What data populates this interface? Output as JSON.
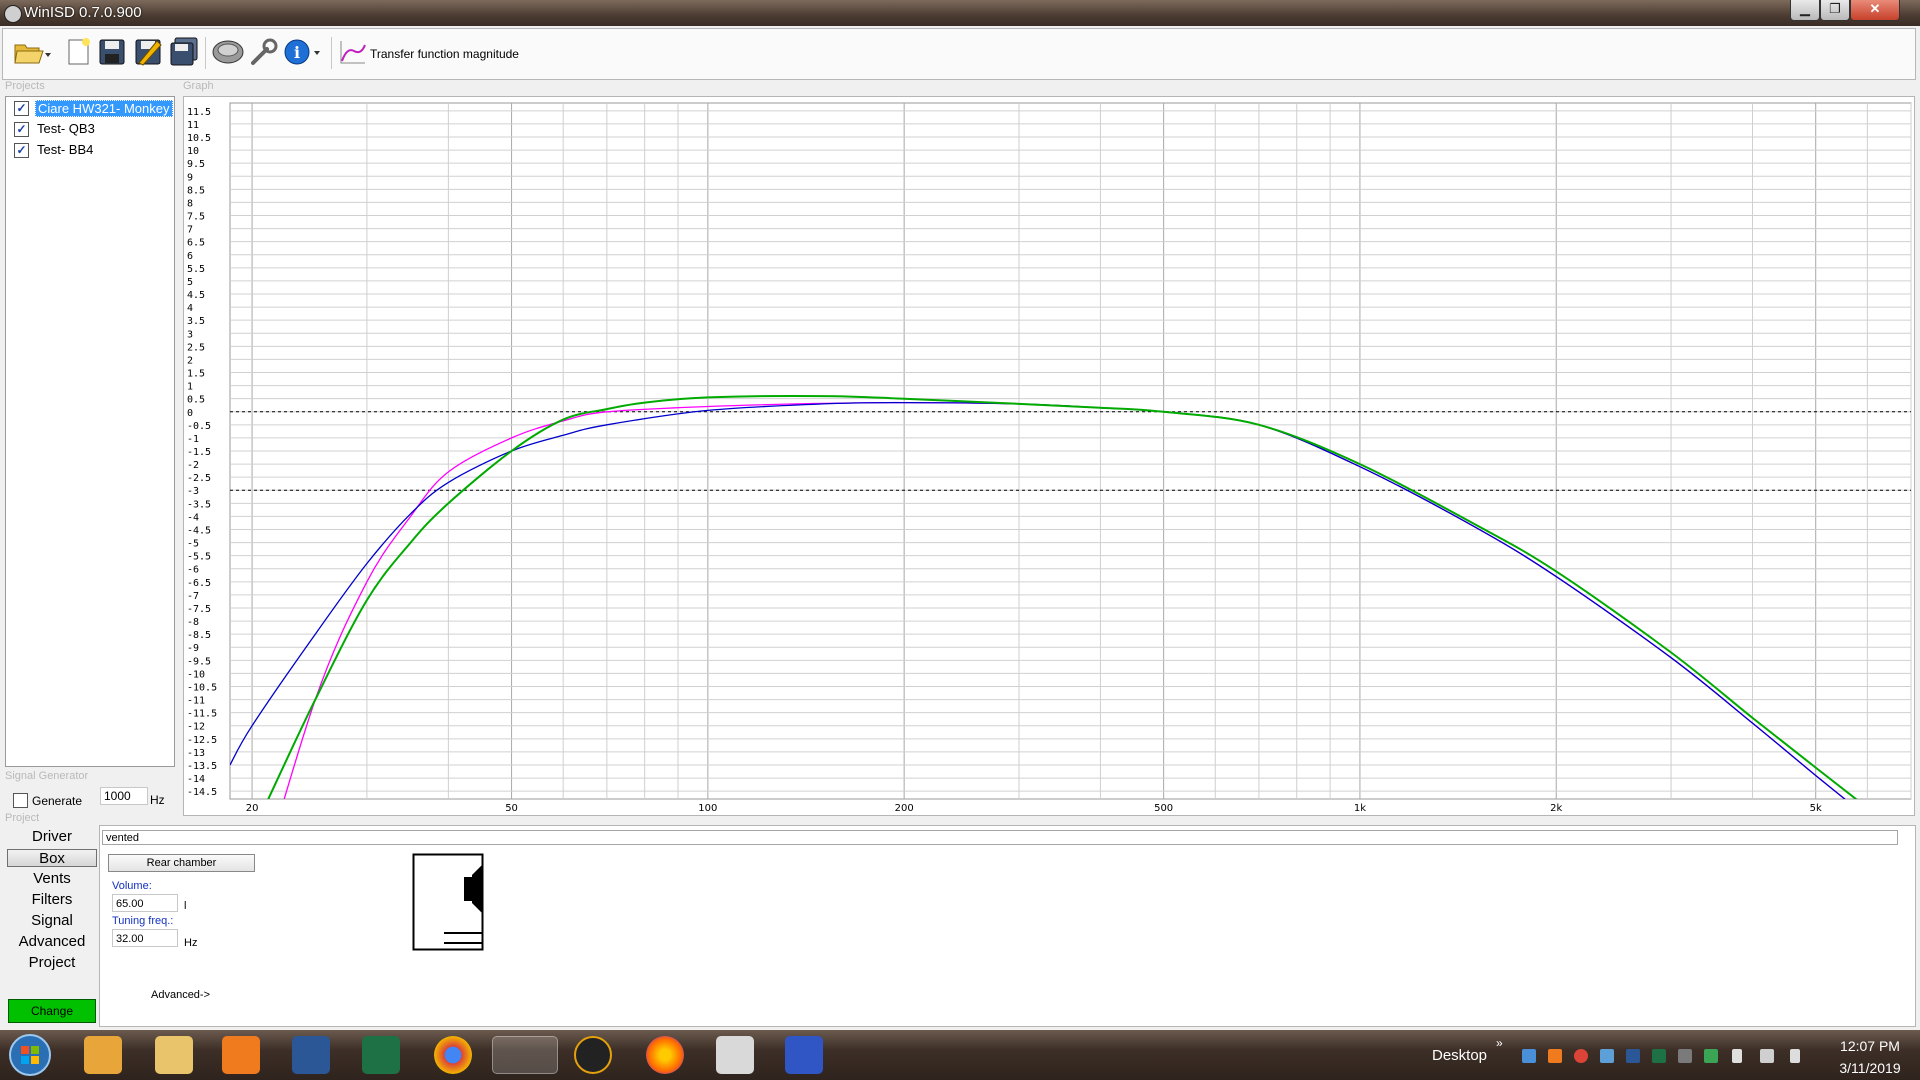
{
  "window": {
    "title": "WinISD 0.7.0.900",
    "minimize": "▁",
    "restore": "❐",
    "close": "✕"
  },
  "toolbar": {
    "tab_label": "Transfer function magnitude"
  },
  "groups": {
    "projects": "Projects",
    "graph": "Graph",
    "signal_generator": "Signal Generator",
    "project": "Project"
  },
  "projects": [
    {
      "label": "Ciare HW321- Monkey",
      "checked": true,
      "selected": true
    },
    {
      "label": "Test- QB3",
      "checked": true,
      "selected": false
    },
    {
      "label": "Test- BB4",
      "checked": true,
      "selected": false
    }
  ],
  "signal": {
    "generate_label": "Generate",
    "frequency": "1000",
    "unit": "Hz"
  },
  "nav": [
    "Driver",
    "Box",
    "Vents",
    "Filters",
    "Signal",
    "Advanced",
    "Project"
  ],
  "nav_selected": "Box",
  "change_label": "Change",
  "box": {
    "type": "vented",
    "rear_chamber": "Rear chamber",
    "volume_label": "Volume:",
    "volume": "65.00",
    "volume_unit": "l",
    "tuning_label": "Tuning freq.:",
    "tuning": "32.00",
    "tuning_unit": "Hz",
    "advanced": "Advanced->"
  },
  "taskbar": {
    "desktop": "Desktop",
    "chevron": "»",
    "time": "12:07 PM",
    "date": "3/11/2019"
  },
  "icons": [
    "open-folder-icon",
    "new-file-icon",
    "save-icon",
    "save-as-icon",
    "save-all-icon",
    "speaker-icon",
    "wrench-icon",
    "info-icon",
    "transfer-function-icon"
  ],
  "chart_data": {
    "type": "line",
    "x_scale": "log",
    "xlim": [
      18.5,
      7000
    ],
    "ylim": [
      -14.8,
      11.8
    ],
    "grid": true,
    "x_ticks": [
      20,
      50,
      100,
      200,
      500,
      1000,
      2000,
      5000
    ],
    "x_tick_labels": [
      "20",
      "50",
      "100",
      "200",
      "500",
      "1k",
      "2k",
      "5k"
    ],
    "y_tick_labels": [
      "11.5",
      "11",
      "10.5",
      "10",
      "9.5",
      "9",
      "8.5",
      "8",
      "7.5",
      "7",
      "6.5",
      "6",
      "5.5",
      "5",
      "4.5",
      "4",
      "3.5",
      "3",
      "2.5",
      "2",
      "1.5",
      "1",
      "0.5",
      "0",
      "-0.5",
      "-1",
      "-1.5",
      "-2",
      "-2.5",
      "-3",
      "-3.5",
      "-4",
      "-4.5",
      "-5",
      "-5.5",
      "-6",
      "-6.5",
      "-7",
      "-7.5",
      "-8",
      "-8.5",
      "-9",
      "-9.5",
      "-10",
      "-10.5",
      "-11",
      "-11.5",
      "-12",
      "-12.5",
      "-13",
      "-13.5",
      "-14",
      "-14.5"
    ],
    "reference_lines": [
      0,
      -3
    ],
    "series": [
      {
        "color": "#ff00ff",
        "points": [
          [
            20,
            -19
          ],
          [
            25,
            -11
          ],
          [
            30,
            -6.5
          ],
          [
            35,
            -4
          ],
          [
            40,
            -2.3
          ],
          [
            50,
            -1
          ],
          [
            60,
            -0.35
          ],
          [
            70,
            0
          ],
          [
            100,
            0.2
          ],
          [
            150,
            0.32
          ],
          [
            200,
            0.35
          ],
          [
            300,
            0.3
          ],
          [
            400,
            0.15
          ],
          [
            500,
            0
          ],
          [
            700,
            -0.5
          ],
          [
            1000,
            -2.1
          ],
          [
            1500,
            -4.4
          ],
          [
            2000,
            -6.3
          ],
          [
            3000,
            -9.4
          ],
          [
            4000,
            -11.9
          ],
          [
            5000,
            -13.9
          ],
          [
            5800,
            -15.2
          ]
        ]
      },
      {
        "color": "#0000cc",
        "points": [
          [
            18.5,
            -13.5
          ],
          [
            20,
            -12
          ],
          [
            25,
            -8.5
          ],
          [
            30,
            -5.8
          ],
          [
            35,
            -3.9
          ],
          [
            40,
            -2.7
          ],
          [
            50,
            -1.5
          ],
          [
            60,
            -0.9
          ],
          [
            70,
            -0.5
          ],
          [
            100,
            0.05
          ],
          [
            150,
            0.3
          ],
          [
            200,
            0.35
          ],
          [
            300,
            0.3
          ],
          [
            400,
            0.15
          ],
          [
            500,
            0
          ],
          [
            700,
            -0.5
          ],
          [
            1000,
            -2.1
          ],
          [
            1500,
            -4.4
          ],
          [
            2000,
            -6.3
          ],
          [
            3000,
            -9.4
          ],
          [
            4000,
            -11.9
          ],
          [
            5000,
            -13.9
          ],
          [
            5800,
            -15.2
          ]
        ]
      },
      {
        "color": "#00aa00",
        "points": [
          [
            21,
            -15
          ],
          [
            25,
            -11
          ],
          [
            30,
            -7.2
          ],
          [
            35,
            -5
          ],
          [
            40,
            -3.5
          ],
          [
            50,
            -1.5
          ],
          [
            60,
            -0.3
          ],
          [
            70,
            0.1
          ],
          [
            80,
            0.35
          ],
          [
            100,
            0.55
          ],
          [
            150,
            0.6
          ],
          [
            200,
            0.5
          ],
          [
            300,
            0.3
          ],
          [
            400,
            0.15
          ],
          [
            500,
            0
          ],
          [
            700,
            -0.5
          ],
          [
            1000,
            -2
          ],
          [
            1500,
            -4.3
          ],
          [
            2000,
            -6.1
          ],
          [
            3000,
            -9.2
          ],
          [
            4000,
            -11.7
          ],
          [
            5000,
            -13.6
          ],
          [
            5900,
            -15
          ]
        ]
      }
    ]
  }
}
